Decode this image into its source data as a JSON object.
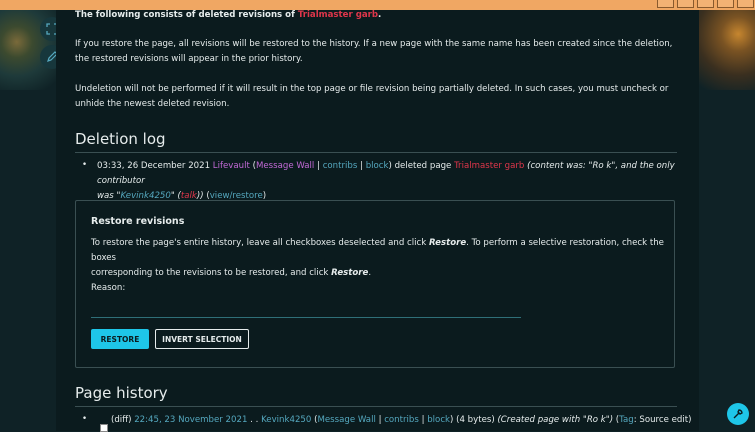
{
  "intro": {
    "title_prefix": "The following consists of deleted revisions of ",
    "title_link": "Trialmaster garb",
    "title_suffix": ".",
    "restore_note": "If you restore the page, all revisions will be restored to the history. If a new page with the same name has been created since the deletion, the restored revisions will appear in the prior history.",
    "undelete_note": "Undeletion will not be performed if it will result in the top page or file revision being partially deleted. In such cases, you must uncheck or unhide the newest deleted revision."
  },
  "deletion_log": {
    "heading": "Deletion log",
    "timestamp": "03:33, 26 December 2021",
    "user": "Lifevault",
    "paren_open": " (",
    "message_wall": "Message Wall",
    "sep1": " | ",
    "contribs": "contribs",
    "sep2": " | ",
    "block": "block",
    "action": ") deleted page ",
    "page": "Trialmaster garb",
    "comment1": " (content was: \"Ro k\", and the only contributor",
    "comment2a": "was \"",
    "contributor": "Kevink4250",
    "comment2b": "\" (",
    "talk": "talk",
    "comment2c": "))",
    "view_open": " (",
    "view_restore": "view/restore",
    "view_close": ")"
  },
  "restore_box": {
    "heading": "Restore revisions",
    "text1a": "To restore the page's entire history, leave all checkboxes deselected and click ",
    "restore_word": "Restore",
    "text1b": ". To perform a selective restoration, check the boxes",
    "text2a": "corresponding to the revisions to be restored, and click ",
    "restore_word2": "Restore",
    "text2b": ".",
    "reason_label": "Reason:",
    "restore_button": "RESTORE",
    "invert_button": "INVERT SELECTION"
  },
  "page_history": {
    "heading": "Page history",
    "diff": "(diff) ",
    "timestamp": "22:45, 23 November 2021",
    "dots": " . . ",
    "user": "Kevink4250",
    "paren_open": " (",
    "message_wall": "Message Wall",
    "sep1": " | ",
    "contribs": "contribs",
    "sep2": " | ",
    "block": "block",
    "size": ") (4 bytes) ",
    "comment": "(Created page with \"Ro k\")",
    "tag_open": " (",
    "tag": "Tag",
    "tag_value": ": Source edit)"
  }
}
